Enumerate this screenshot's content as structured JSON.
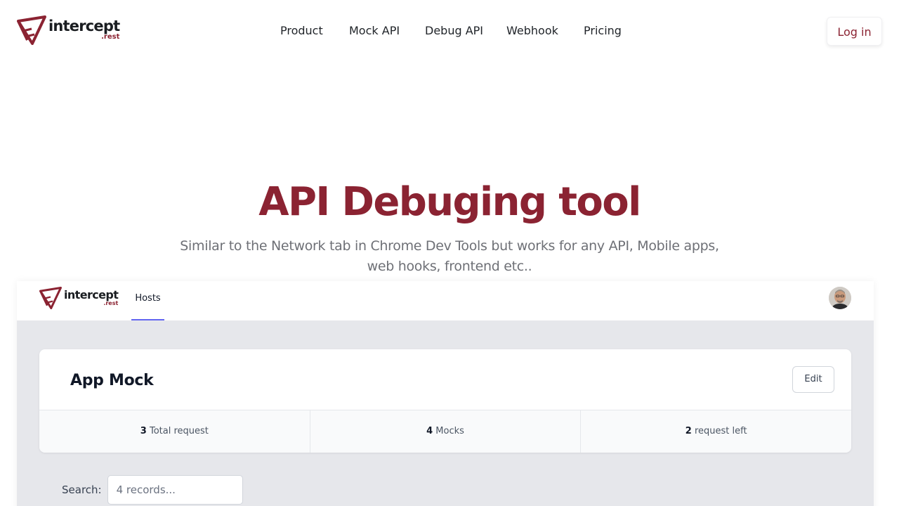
{
  "brand": {
    "word": "intercept",
    "tld": ".rest",
    "color": "#8b2332",
    "logo_icon": "paper-plane-logo-icon"
  },
  "nav": {
    "links": [
      "Product",
      "Mock API",
      "Debug API",
      "Webhook",
      "Pricing"
    ],
    "login_label": "Log in"
  },
  "hero": {
    "title": "API Debuging tool",
    "subtitle": "Similar to the Network tab in Chrome Dev Tools but works for any API, Mobile apps, web hooks, frontend etc.."
  },
  "preview": {
    "brand_word": "intercept",
    "brand_tld": ".rest",
    "tab": "Hosts",
    "tab_accent": "#6366f1",
    "avatar_icon": "user-avatar",
    "card": {
      "title": "App Mock",
      "edit_label": "Edit",
      "stats": [
        {
          "value": "3",
          "label": "Total request"
        },
        {
          "value": "4",
          "label": "Mocks"
        },
        {
          "value": "2",
          "label": "request left"
        }
      ]
    },
    "search": {
      "label": "Search:",
      "placeholder": "4 records..."
    }
  }
}
